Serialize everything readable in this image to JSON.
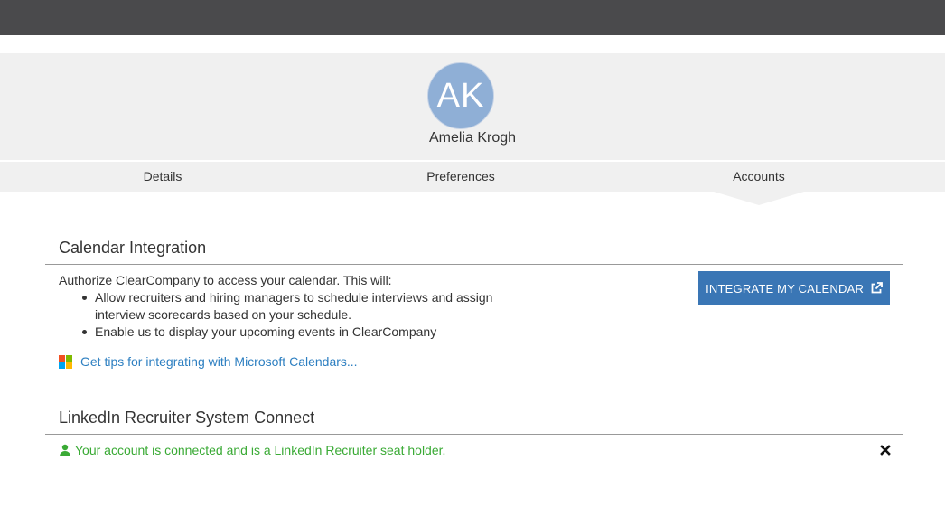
{
  "profile": {
    "initials": "AK",
    "name": "Amelia Krogh",
    "avatar_color": "#8fafd6"
  },
  "tabs": [
    {
      "label": "Details"
    },
    {
      "label": "Preferences"
    },
    {
      "label": "Accounts",
      "active": true
    }
  ],
  "calendar": {
    "title": "Calendar Integration",
    "intro": "Authorize ClearCompany to access your calendar. This will:",
    "bullets": [
      "Allow recruiters and hiring managers to schedule interviews and assign interview scorecards based on your schedule.",
      "Enable us to display your upcoming events in ClearCompany"
    ],
    "tips_link": "Get tips for integrating with Microsoft Calendars...",
    "button_label": "INTEGRATE MY CALENDAR",
    "button_color": "#3a76b5",
    "icons": {
      "link": "microsoft-logo-icon",
      "button": "external-link-icon"
    }
  },
  "linkedin": {
    "title": "LinkedIn Recruiter System Connect",
    "status": "Your account is connected and is a LinkedIn Recruiter seat holder.",
    "status_color": "#3aaa35",
    "icons": {
      "status": "user-icon",
      "dismiss": "close-icon"
    }
  },
  "colors": {
    "top_bar": "#4a4a4c",
    "band": "#f0f0f0",
    "link": "#2d7fc1"
  }
}
